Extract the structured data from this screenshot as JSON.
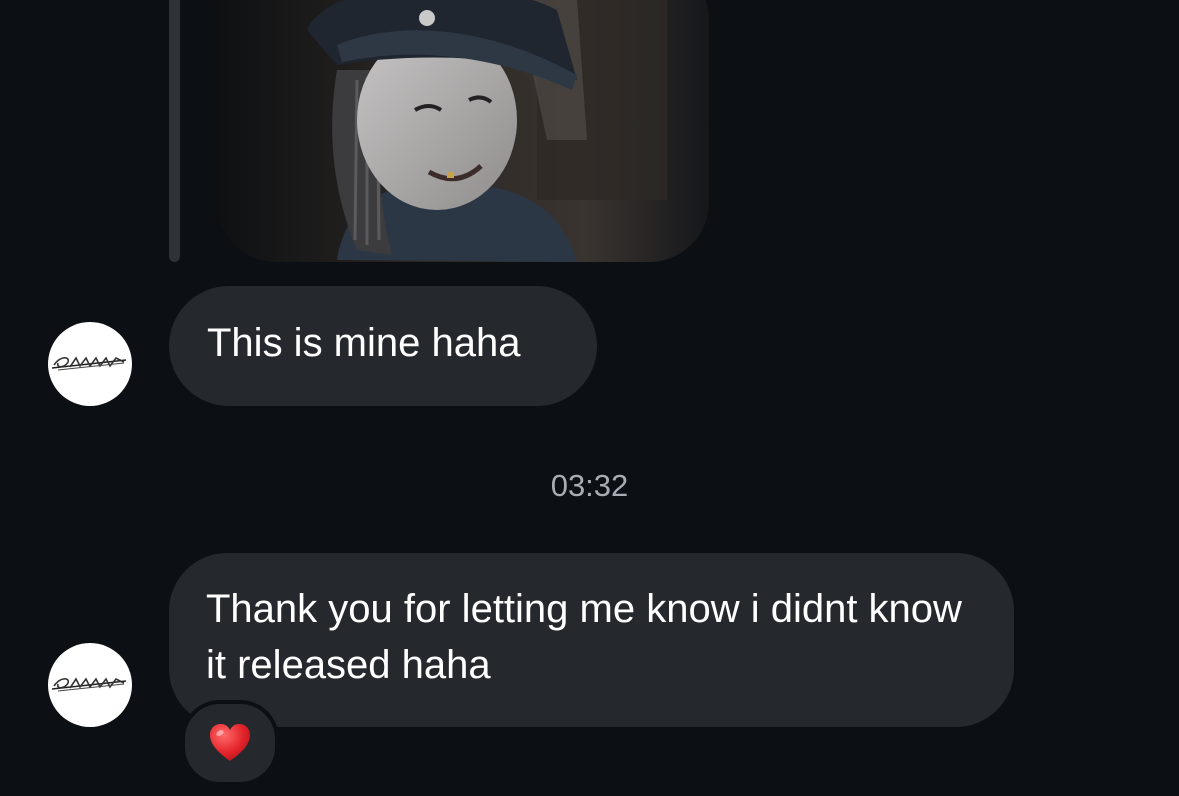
{
  "conversation": {
    "messages": [
      {
        "text": "This is mine haha"
      },
      {
        "text": "Thank you for letting me know i didnt know it released haha"
      }
    ],
    "timestamp": "03:32",
    "reaction": {
      "icon": "heart-emoji"
    },
    "avatar": {
      "icon": "logo-avatar"
    }
  },
  "colors": {
    "background": "#0c1014",
    "bubble": "#25292e",
    "text": "#ffffff",
    "timestamp": "#a8adb3",
    "heart": "#e3242b"
  }
}
